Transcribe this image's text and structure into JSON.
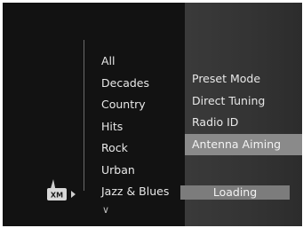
{
  "categories": {
    "items": [
      "All",
      "Decades",
      "Country",
      "Hits",
      "Rock",
      "Urban",
      "Jazz & Blues"
    ],
    "more_indicator": "∨"
  },
  "logo": {
    "text": "XM",
    "icon": "xm-radio-logo-icon"
  },
  "settings_menu": {
    "items": [
      "Preset Mode",
      "Direct Tuning",
      "Radio ID",
      "Antenna Aiming"
    ],
    "selected": "Antenna Aiming"
  },
  "status": {
    "loading_label": "Loading"
  },
  "colors": {
    "background": "#121212",
    "panel": "#363636",
    "highlight": "#8a8a8a"
  }
}
